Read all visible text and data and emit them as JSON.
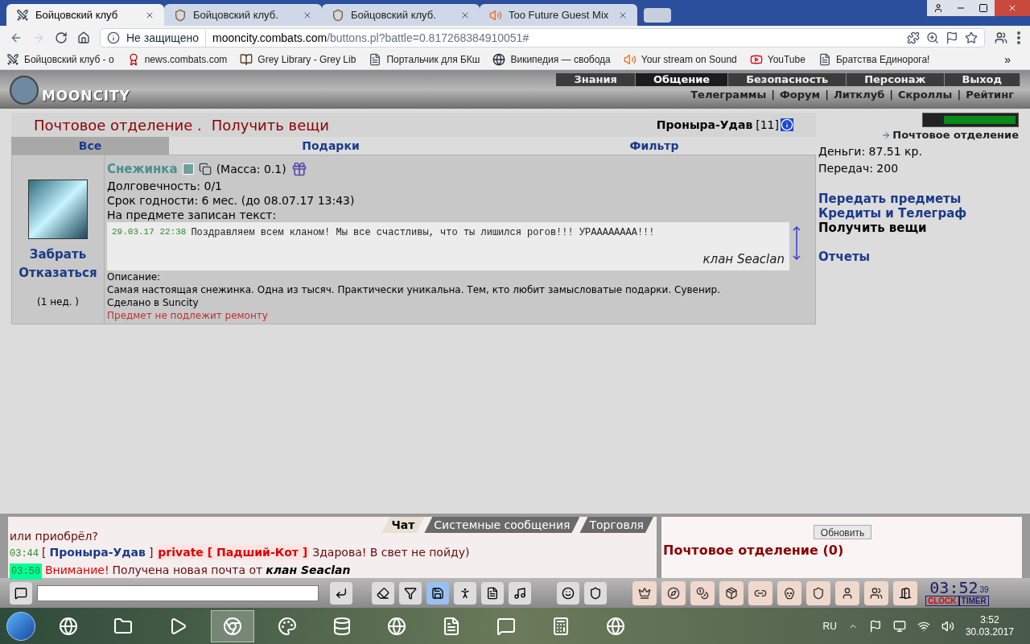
{
  "browser": {
    "tabs": [
      {
        "title": "Бойцовский клуб",
        "selected": true,
        "kind": "swords"
      },
      {
        "title": "Бойцовский клуб.",
        "selected": false,
        "kind": "shield"
      },
      {
        "title": "Бойцовский клуб.",
        "selected": false,
        "kind": "shield"
      },
      {
        "title": "Too Future Guest Mix",
        "selected": false,
        "kind": "audio"
      }
    ],
    "security": "Не защищено",
    "url_host": "mooncity.combats.com",
    "url_path": "/buttons.pl?battle=0.817268384910051#",
    "bookmarks": [
      {
        "label": "Бойцовский клуб - о",
        "kind": "swords"
      },
      {
        "label": "news.combats.com",
        "kind": "badge"
      },
      {
        "label": "Grey Library - Grey Lib",
        "kind": "book"
      },
      {
        "label": "Портальчик для БКш",
        "kind": "page"
      },
      {
        "label": "Википедия — свобода",
        "kind": "wiki"
      },
      {
        "label": "Your stream on Sound",
        "kind": "audio"
      },
      {
        "label": "YouTube",
        "kind": "video"
      },
      {
        "label": "Братства Единорога!",
        "kind": "page"
      }
    ],
    "overflow": "»"
  },
  "game": {
    "logo": "MOONCITY",
    "nav": [
      {
        "label": "Знания",
        "selected": false
      },
      {
        "label": "Общение",
        "selected": true
      },
      {
        "label": "Безопасность",
        "selected": false
      },
      {
        "label": "Персонаж",
        "selected": false
      },
      {
        "label": "Выход",
        "selected": false
      }
    ],
    "subnav": [
      "Телеграммы",
      "Форум",
      "Литклуб",
      "Скроллы",
      "Рейтинг"
    ],
    "separator": "|",
    "title": "Почтовое отделение .",
    "subtitle": "Получить вещи",
    "user": "Проныра-Удав",
    "user_level": "[11]",
    "filters": [
      {
        "label": "Все",
        "selected": true
      },
      {
        "label": "Подарки",
        "selected": false
      },
      {
        "label": "Фильтр",
        "selected": false
      }
    ],
    "item": {
      "actions": [
        "Забрать",
        "Отказаться"
      ],
      "age": "(1 нед. )",
      "name": "Снежинка",
      "mass": "(Масса: 0.1)",
      "lines": [
        "Долговечность: 0/1",
        "Срок годности: 6 мес. (до 08.07.17 13:43)",
        "На предмете записан текст:"
      ],
      "note": {
        "date": "29.03.17 22:38",
        "text": "Поздравляем всем кланом! Мы все счастливы, что ты лишился рогов!!! УРАААААААА!!!",
        "signature": "клан Seaclan"
      },
      "description": [
        "Описание:",
        "Самая настоящая снежинка. Одна из тысяч. Практически уникальна. Тем, кто любит замысловатые подарки. Сувенир.",
        "Сделано в Suncity"
      ],
      "repair": "Предмет не подлежит ремонту"
    },
    "sidebar": {
      "location": "Почтовое отделение",
      "money": "Деньги: 87.51 кр.",
      "transfers": "Передач: 200",
      "links": [
        {
          "label": "Передать предметы",
          "selected": false
        },
        {
          "label": "Кредиты и Телеграф",
          "selected": false
        },
        {
          "label": "Получить вещи",
          "selected": true
        },
        {
          "label": "Отчеты",
          "selected": false
        }
      ]
    },
    "chat": {
      "tabs": [
        {
          "label": "Чат",
          "selected": true
        },
        {
          "label": "Системные сообщения",
          "selected": false
        },
        {
          "label": "Торговля",
          "selected": false
        }
      ],
      "messages": [
        [
          {
            "kind": "text",
            "text": "или приобрёл?"
          }
        ],
        [
          {
            "kind": "time",
            "text": "03:44"
          },
          {
            "kind": "text",
            "text": "["
          },
          {
            "kind": "nick",
            "text": "Проныра-Удав"
          },
          {
            "kind": "text",
            "text": "]"
          },
          {
            "kind": "private",
            "text": "private [ Падший-Кот ]"
          },
          {
            "kind": "text",
            "text": "Здарова! В свет не пойду)"
          }
        ],
        [
          {
            "kind": "time_new",
            "text": "03:50"
          },
          {
            "kind": "alert",
            "text": "Внимание!"
          },
          {
            "kind": "text",
            "text": "Получена новая почта от"
          },
          {
            "kind": "sender",
            "text": "клан Seaclan"
          }
        ]
      ]
    },
    "mail_panel": {
      "button": "Обновить",
      "title": "Почтовое отделение (0)"
    },
    "clock": {
      "time": "03:52",
      "seconds": "39",
      "clock_label": "CLOCK",
      "timer_label": "TIMER"
    }
  },
  "taskbar": {
    "language": "RU",
    "time": "3:52",
    "date": "30.03.2017"
  }
}
